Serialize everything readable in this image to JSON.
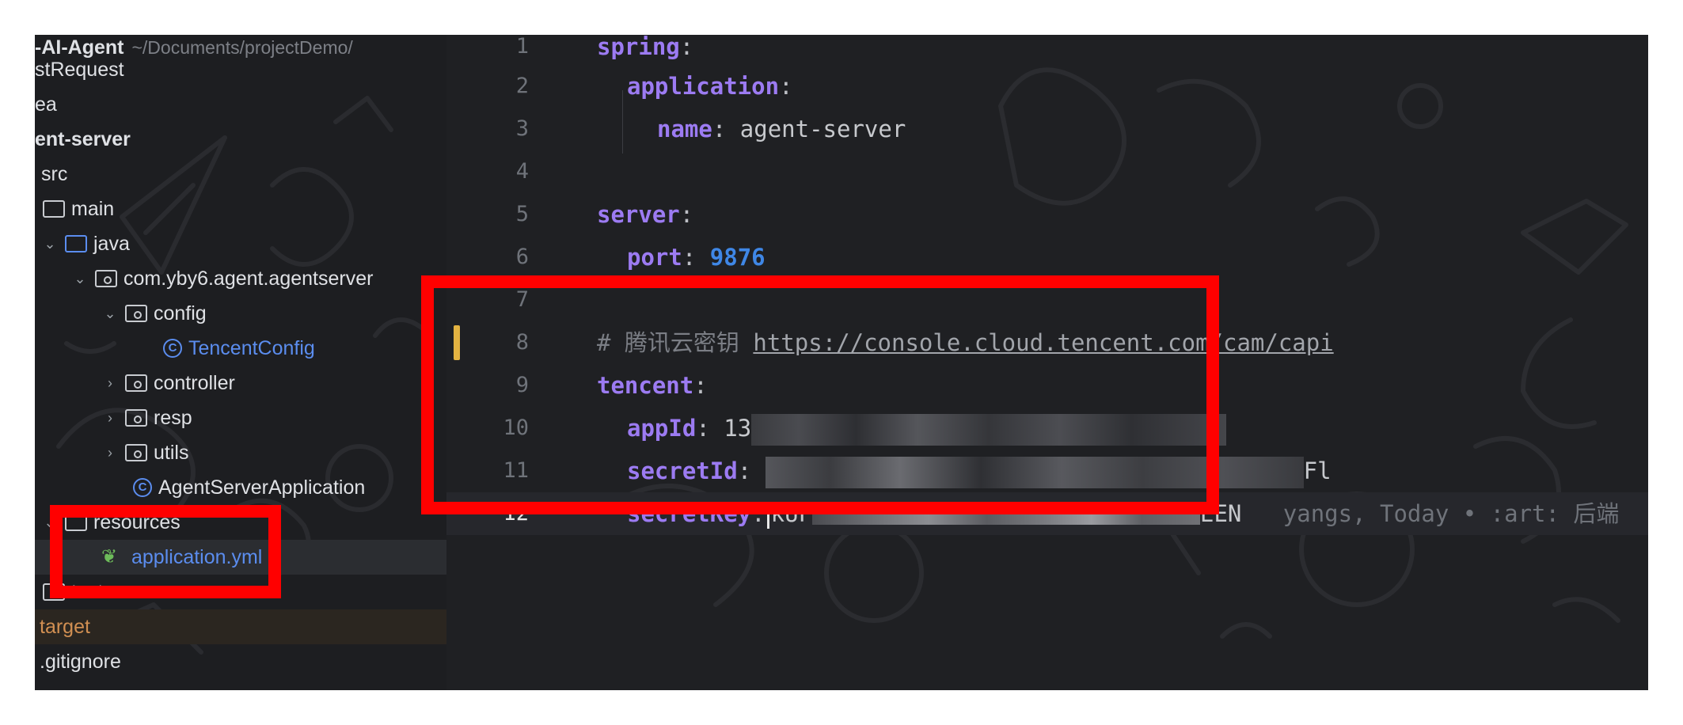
{
  "project_tree": {
    "root": {
      "name": "-AI-Agent",
      "path": "~/Documents/projectDemo/"
    },
    "items": [
      {
        "label": "stRequest"
      },
      {
        "label": "ea"
      },
      {
        "label": "ent-server"
      },
      {
        "label": "src"
      },
      {
        "label": "main"
      },
      {
        "label": "java"
      },
      {
        "label": "com.yby6.agent.agentserver"
      },
      {
        "label": "config"
      },
      {
        "label": "TencentConfig"
      },
      {
        "label": "controller"
      },
      {
        "label": "resp"
      },
      {
        "label": "utils"
      },
      {
        "label": "AgentServerApplication"
      },
      {
        "label": "resources"
      },
      {
        "label": "application.yml"
      },
      {
        "label": "test"
      },
      {
        "label": "target"
      },
      {
        "label": ".gitignore"
      }
    ]
  },
  "editor": {
    "line_numbers": [
      "1",
      "2",
      "3",
      "4",
      "5",
      "6",
      "7",
      "8",
      "9",
      "10",
      "11",
      "12"
    ],
    "lines": {
      "l1": {
        "key": "spring",
        "punc": ":"
      },
      "l2": {
        "key": "application",
        "punc": ":"
      },
      "l3": {
        "key": "name",
        "punc": ":",
        "value": "agent-server"
      },
      "l5": {
        "key": "server",
        "punc": ":"
      },
      "l6": {
        "key": "port",
        "punc": ":",
        "value": "9876"
      },
      "l8": {
        "comment": "# 腾讯云密钥",
        "link": "https://console.cloud.tencent.com/cam/capi"
      },
      "l9": {
        "key": "tencent",
        "punc": ":"
      },
      "l10": {
        "key": "appId",
        "punc": ":",
        "value_visible": "13"
      },
      "l11": {
        "key": "secretId",
        "punc": ":",
        "value_tail": "Fl"
      },
      "l12": {
        "key": "secretKey",
        "punc": ":",
        "value_head": "kUF",
        "value_tail": "EEN",
        "blame": "yangs, Today • :art: 后端"
      }
    }
  },
  "colors": {
    "yaml_key": "#9c7bf2",
    "number": "#3f87e6",
    "highlight_box": "#ff0000",
    "selection_blue": "#5b8def",
    "target_orange": "#d18f52"
  }
}
